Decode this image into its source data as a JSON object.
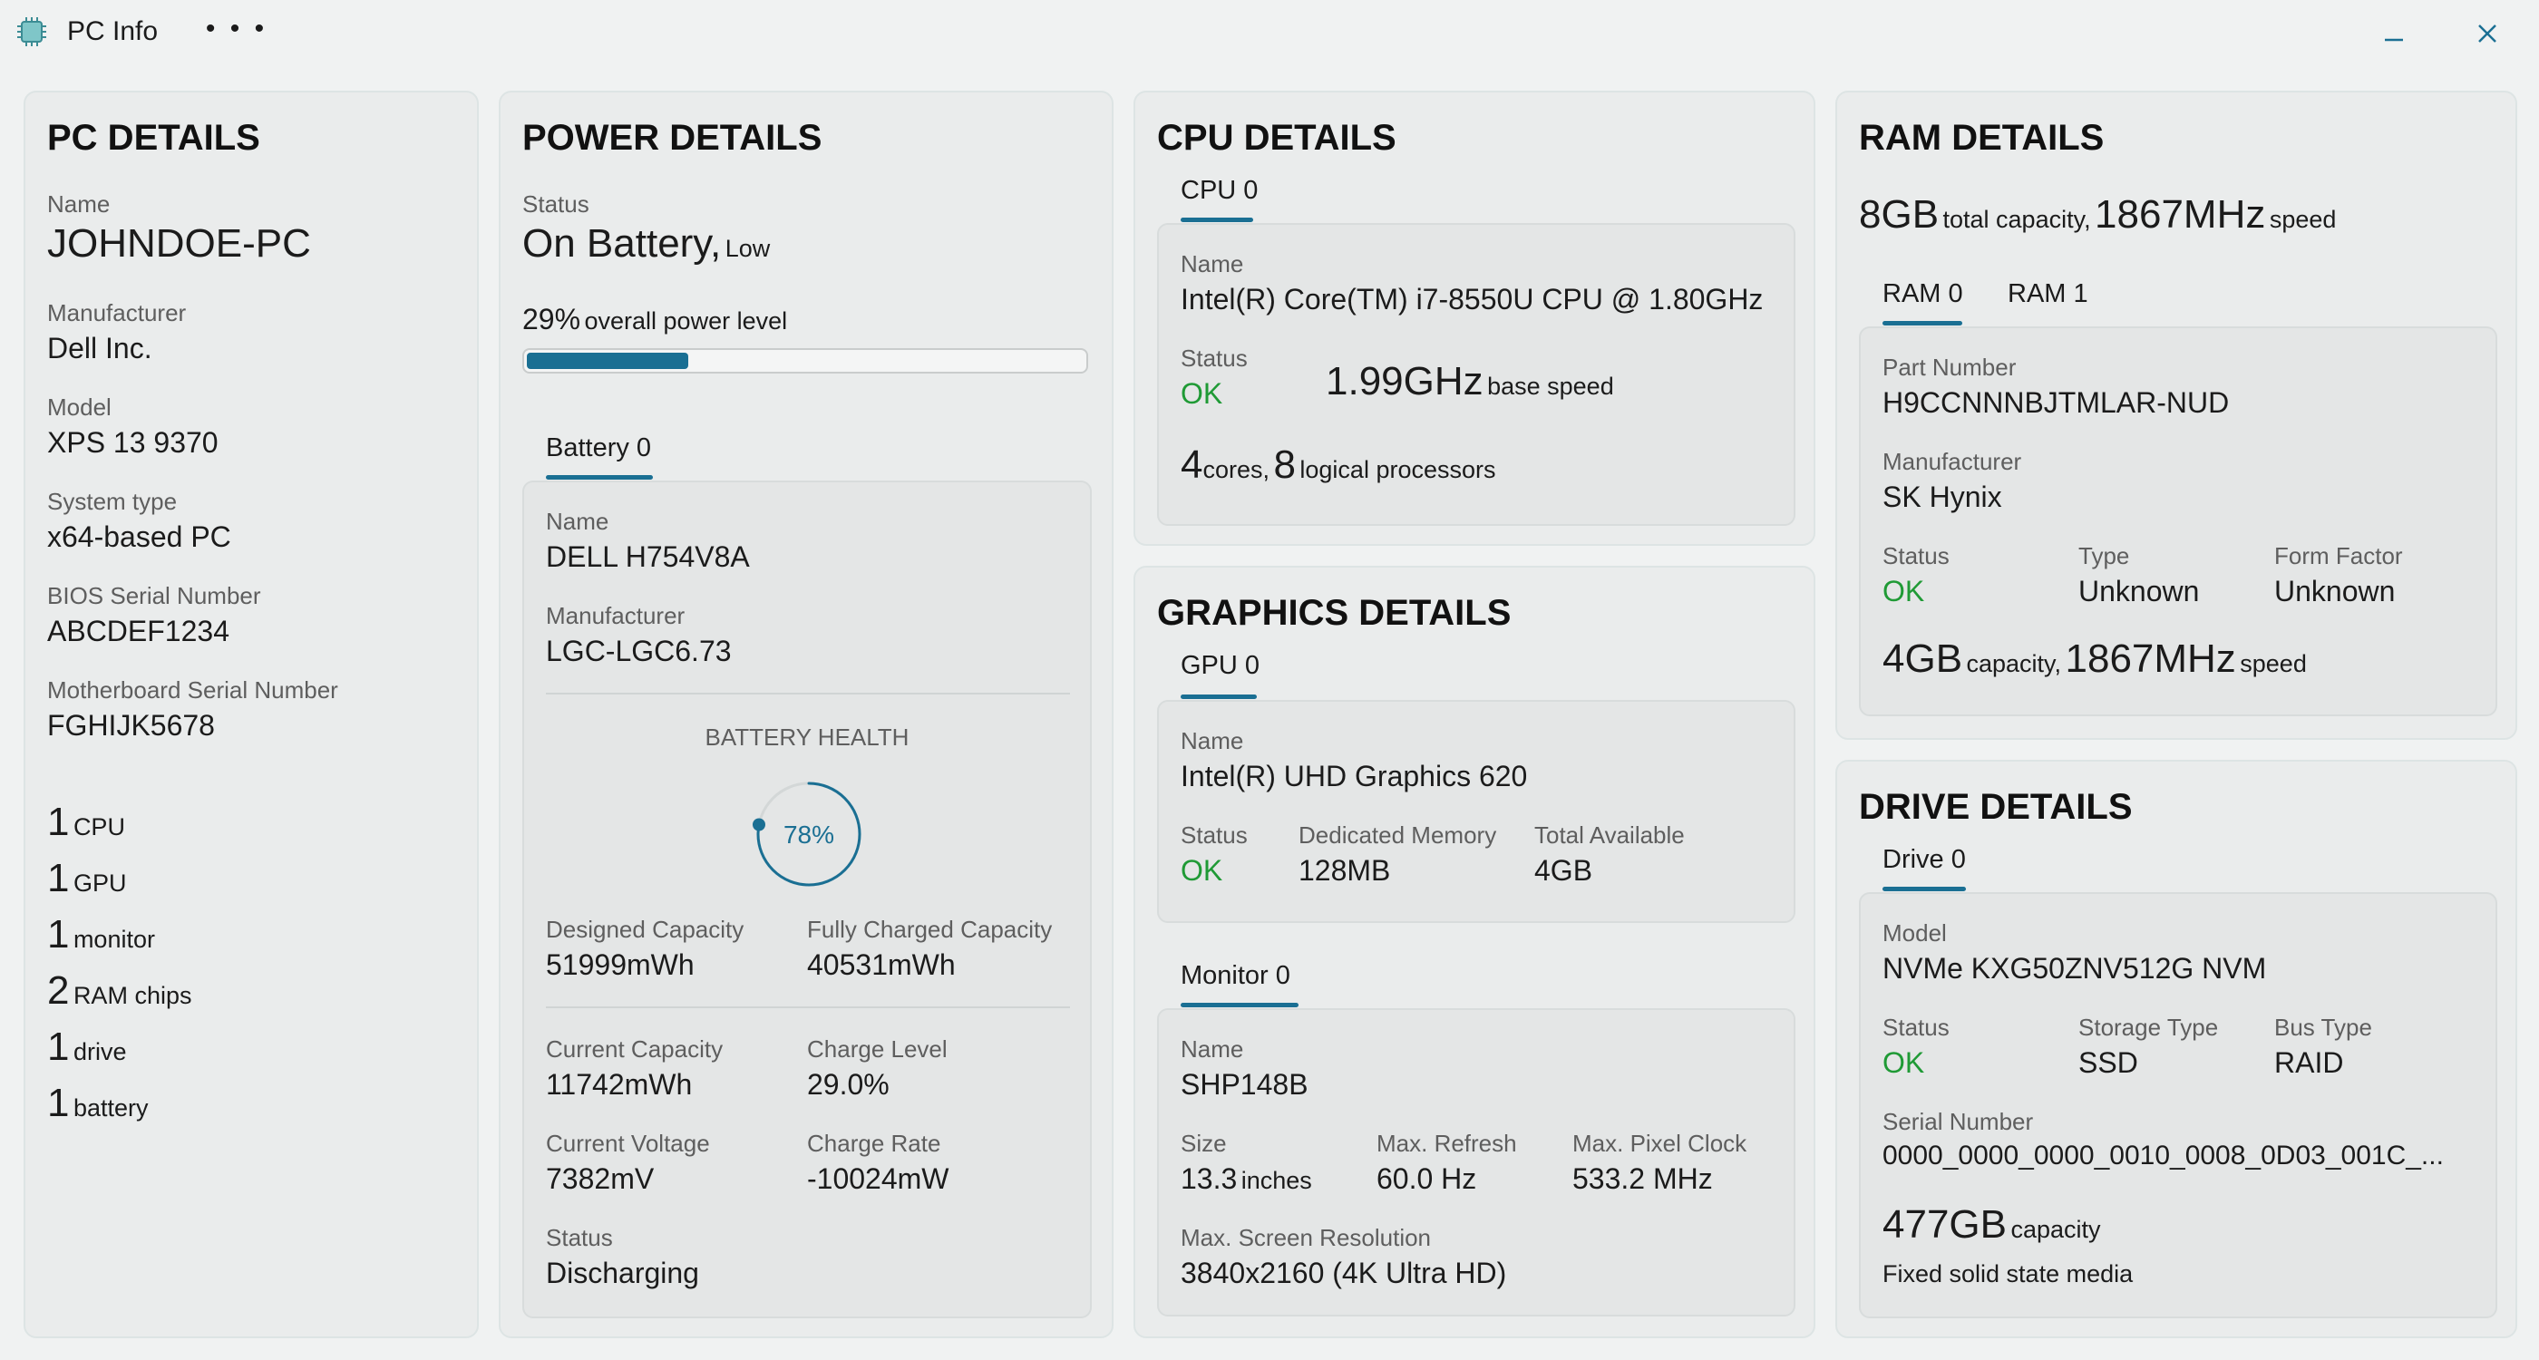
{
  "window": {
    "title": "PC Info",
    "more": "• • •"
  },
  "pc": {
    "heading": "PC DETAILS",
    "name_label": "Name",
    "name": "JOHNDOE-PC",
    "manufacturer_label": "Manufacturer",
    "manufacturer": "Dell Inc.",
    "model_label": "Model",
    "model": "XPS 13 9370",
    "system_type_label": "System type",
    "system_type": "x64-based PC",
    "bios_label": "BIOS Serial Number",
    "bios": "ABCDEF1234",
    "mobo_label": "Motherboard Serial Number",
    "mobo": "FGHIJK5678",
    "counts": [
      {
        "n": "1",
        "label": "CPU"
      },
      {
        "n": "1",
        "label": "GPU"
      },
      {
        "n": "1",
        "label": "monitor"
      },
      {
        "n": "2",
        "label": "RAM chips"
      },
      {
        "n": "1",
        "label": "drive"
      },
      {
        "n": "1",
        "label": "battery"
      }
    ]
  },
  "power": {
    "heading": "POWER DETAILS",
    "status_label": "Status",
    "status": "On Battery,",
    "status_level": "Low",
    "level_value": "29%",
    "level_label": "overall power level",
    "level_fraction": 0.29,
    "tab": "Battery 0",
    "name_label": "Name",
    "name": "DELL H754V8A",
    "manufacturer_label": "Manufacturer",
    "manufacturer": "LGC-LGC6.73",
    "health_label": "BATTERY HEALTH",
    "health": "78%",
    "health_fraction": 0.78,
    "designed_label": "Designed Capacity",
    "designed": "51999mWh",
    "full_label": "Fully Charged Capacity",
    "full": "40531mWh",
    "current_cap_label": "Current Capacity",
    "current_cap": "11742mWh",
    "charge_level_label": "Charge Level",
    "charge_level": "29.0%",
    "voltage_label": "Current Voltage",
    "voltage": "7382mV",
    "rate_label": "Charge Rate",
    "rate": "-10024mW",
    "bstatus_label": "Status",
    "bstatus": "Discharging"
  },
  "cpu": {
    "heading": "CPU DETAILS",
    "tab": "CPU 0",
    "name_label": "Name",
    "name": "Intel(R) Core(TM) i7-8550U CPU @ 1.80GHz",
    "status_label": "Status",
    "status": "OK",
    "speed": "1.99GHz",
    "speed_label": "base speed",
    "cores": "4",
    "cores_label": "cores,",
    "logical": "8",
    "logical_label": "logical processors"
  },
  "graphics": {
    "heading": "GRAPHICS DETAILS",
    "tab": "GPU 0",
    "name_label": "Name",
    "name": "Intel(R) UHD Graphics 620",
    "status_label": "Status",
    "status": "OK",
    "dedicated_label": "Dedicated Memory",
    "dedicated": "128MB",
    "total_label": "Total Available",
    "total": "4GB",
    "monitor_tab": "Monitor 0",
    "mon_name_label": "Name",
    "mon_name": "SHP148B",
    "size_label": "Size",
    "size": "13.3",
    "size_unit": "inches",
    "refresh_label": "Max. Refresh",
    "refresh": "60.0 Hz",
    "clock_label": "Max. Pixel Clock",
    "clock": "533.2 MHz",
    "res_label": "Max. Screen Resolution",
    "res": "3840x2160 (4K Ultra HD)"
  },
  "ram": {
    "heading": "RAM DETAILS",
    "total": "8GB",
    "total_label": "total capacity,",
    "speed": "1867MHz",
    "speed_label": "speed",
    "tabs": [
      "RAM 0",
      "RAM 1"
    ],
    "part_label": "Part Number",
    "part": "H9CCNNNBJTMLAR-NUD",
    "manufacturer_label": "Manufacturer",
    "manufacturer": "SK Hynix",
    "status_label": "Status",
    "status": "OK",
    "type_label": "Type",
    "type": "Unknown",
    "form_label": "Form Factor",
    "form": "Unknown",
    "capacity": "4GB",
    "capacity_label": "capacity,",
    "chip_speed": "1867MHz",
    "chip_speed_label": "speed"
  },
  "drive": {
    "heading": "DRIVE DETAILS",
    "tab": "Drive 0",
    "model_label": "Model",
    "model": "NVMe KXG50ZNV512G NVM",
    "status_label": "Status",
    "status": "OK",
    "storage_label": "Storage Type",
    "storage": "SSD",
    "bus_label": "Bus Type",
    "bus": "RAID",
    "serial_label": "Serial Number",
    "serial": "0000_0000_0000_0010_0008_0D03_001C_...",
    "capacity": "477GB",
    "capacity_label": "capacity",
    "media": "Fixed solid state media"
  },
  "colors": {
    "accent": "#1a6f93",
    "ok": "#1f9a35",
    "panel": "#eaecec",
    "card": "#e4e6e6"
  }
}
